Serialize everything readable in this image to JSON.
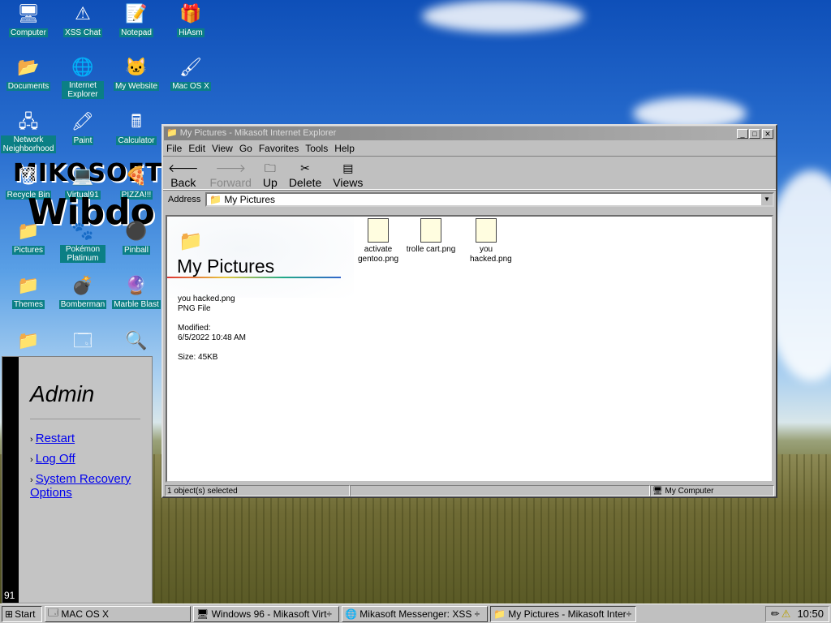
{
  "desktop": {
    "icons": [
      {
        "label": "Computer",
        "icon": "computer-icon",
        "glyph": "🖥"
      },
      {
        "label": "XSS Chat",
        "icon": "warning-chat-icon",
        "glyph": "⚠"
      },
      {
        "label": "Notepad",
        "icon": "notepad-icon",
        "glyph": "📝"
      },
      {
        "label": "HiAsm",
        "icon": "hiasm-icon",
        "glyph": "🎁"
      },
      {
        "label": "Documents",
        "icon": "folder-icon",
        "glyph": "📂"
      },
      {
        "label": "Internet Explorer",
        "icon": "ie-icon",
        "glyph": "🌐"
      },
      {
        "label": "My Website",
        "icon": "github-icon",
        "glyph": "🐱"
      },
      {
        "label": "Mac OS X",
        "icon": "shortcut-icon",
        "glyph": "🖌"
      },
      {
        "label": "Network Neighborhood",
        "icon": "network-icon",
        "glyph": "🖧"
      },
      {
        "label": "Paint",
        "icon": "paint-icon",
        "glyph": "🖍"
      },
      {
        "label": "Calculator",
        "icon": "calculator-icon",
        "glyph": "🖩"
      },
      {
        "label": "Recycle Bin",
        "icon": "recycle-bin-icon",
        "glyph": "🗑"
      },
      {
        "label": "Virtual91",
        "icon": "virtual-pc-icon",
        "glyph": "💻"
      },
      {
        "label": "PIZZA!!!",
        "icon": "pizza-icon",
        "glyph": "🍕"
      },
      {
        "label": "Pictures",
        "icon": "folder-icon",
        "glyph": "📁"
      },
      {
        "label": "Pokémon Platinum",
        "icon": "pokemon-icon",
        "glyph": "🐾"
      },
      {
        "label": "Pinball",
        "icon": "pinball-icon",
        "glyph": "⚫"
      },
      {
        "label": "Themes",
        "icon": "folder-icon",
        "glyph": "📁"
      },
      {
        "label": "Bomberman",
        "icon": "bomberman-icon",
        "glyph": "💣"
      },
      {
        "label": "Marble Blast",
        "icon": "marble-icon",
        "glyph": "🔮"
      }
    ],
    "wordart_top": "MIKOSOFT",
    "wordart_bottom": "Wibdo"
  },
  "window": {
    "title": "My Pictures - Mikasoft Internet Explorer",
    "menu": [
      "File",
      "Edit",
      "View",
      "Go",
      "Favorites",
      "Tools",
      "Help"
    ],
    "toolbar": {
      "back": "Back",
      "forward": "Forward",
      "up": "Up",
      "delete": "Delete",
      "views": "Views"
    },
    "address_label": "Address",
    "address_value": "My Pictures",
    "folder_heading": "My Pictures",
    "selected_name": "you hacked.png",
    "selected_type": "PNG File",
    "modified_label": "Modified:",
    "modified_value": "6/5/2022 10:48 AM",
    "size": "Size: 45KB",
    "files": [
      "activate gentoo.png",
      "trolle cart.png",
      "you hacked.png"
    ],
    "status_left": "1 object(s) selected",
    "status_right": "My Computer"
  },
  "admin_menu": {
    "title": "Admin",
    "links": [
      "Restart",
      "Log Off",
      "System Recovery Options"
    ],
    "side_label": "91"
  },
  "taskbar": {
    "start": "Start",
    "buttons": [
      "MAC OS X",
      "Windows 96 - Mikasoft Virt÷",
      "Mikasoft Messenger: XSS ÷",
      "My Pictures - Mikasoft Inter÷"
    ],
    "clock": "10:50"
  }
}
